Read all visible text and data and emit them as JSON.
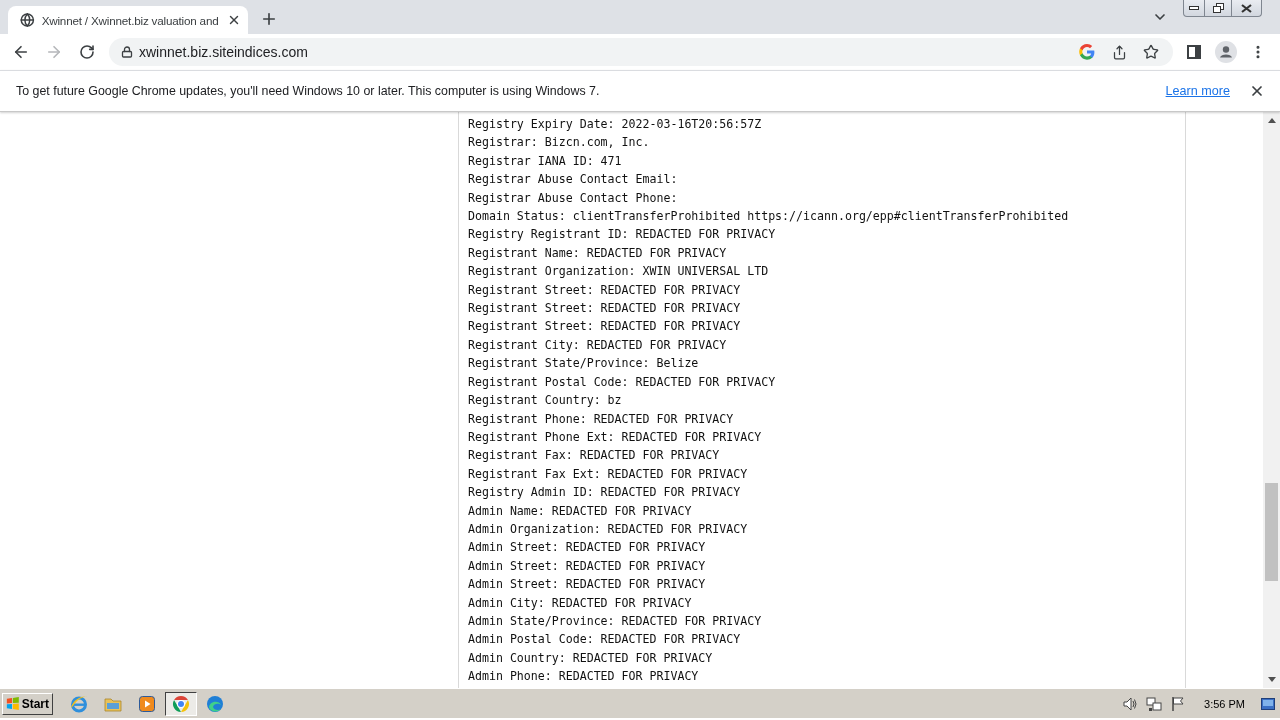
{
  "browser": {
    "tabs": [
      {
        "title": "Xwinnet / Xwinnet.biz valuation and",
        "selected": true
      }
    ],
    "address_bar": {
      "url": "xwinnet.biz.siteindices.com"
    }
  },
  "infobar": {
    "message": "To get future Google Chrome updates, you'll need Windows 10 or later. This computer is using Windows 7.",
    "link": "Learn more"
  },
  "whois_lines": [
    "Registry Expiry Date: 2022-03-16T20:56:57Z",
    "Registrar: Bizcn.com, Inc.",
    "Registrar IANA ID: 471",
    "Registrar Abuse Contact Email:",
    "Registrar Abuse Contact Phone:",
    "Domain Status: clientTransferProhibited https://icann.org/epp#clientTransferProhibited",
    "Registry Registrant ID: REDACTED FOR PRIVACY",
    "Registrant Name: REDACTED FOR PRIVACY",
    "Registrant Organization: XWIN UNIVERSAL LTD",
    "Registrant Street: REDACTED FOR PRIVACY",
    "Registrant Street: REDACTED FOR PRIVACY",
    "Registrant Street: REDACTED FOR PRIVACY",
    "Registrant City: REDACTED FOR PRIVACY",
    "Registrant State/Province: Belize",
    "Registrant Postal Code: REDACTED FOR PRIVACY",
    "Registrant Country: bz",
    "Registrant Phone: REDACTED FOR PRIVACY",
    "Registrant Phone Ext: REDACTED FOR PRIVACY",
    "Registrant Fax: REDACTED FOR PRIVACY",
    "Registrant Fax Ext: REDACTED FOR PRIVACY",
    "Registry Admin ID: REDACTED FOR PRIVACY",
    "Admin Name: REDACTED FOR PRIVACY",
    "Admin Organization: REDACTED FOR PRIVACY",
    "Admin Street: REDACTED FOR PRIVACY",
    "Admin Street: REDACTED FOR PRIVACY",
    "Admin Street: REDACTED FOR PRIVACY",
    "Admin City: REDACTED FOR PRIVACY",
    "Admin State/Province: REDACTED FOR PRIVACY",
    "Admin Postal Code: REDACTED FOR PRIVACY",
    "Admin Country: REDACTED FOR PRIVACY",
    "Admin Phone: REDACTED FOR PRIVACY"
  ],
  "taskbar": {
    "start_label": "Start",
    "apps": [
      {
        "kind": "ie",
        "selected": false
      },
      {
        "kind": "explorer",
        "selected": false
      },
      {
        "kind": "media",
        "selected": false
      },
      {
        "kind": "chrome",
        "selected": true
      },
      {
        "kind": "edge",
        "selected": false
      }
    ],
    "clock": "3:56 PM"
  }
}
